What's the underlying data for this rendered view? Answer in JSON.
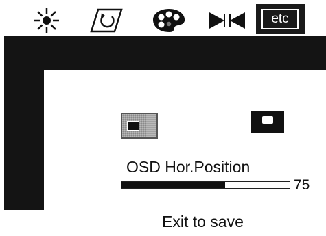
{
  "tabs": [
    {
      "icon": "brightness-sun-icon"
    },
    {
      "icon": "geometry-rotate-icon"
    },
    {
      "icon": "color-palette-icon"
    },
    {
      "icon": "size-bowtie-icon"
    },
    {
      "label": "etc",
      "icon": "etc-icon",
      "selected": true
    }
  ],
  "setting": {
    "label": "OSD Hor.Position",
    "value": 75,
    "value_text": "75",
    "min_icon": "osd-left-position-icon",
    "max_icon": "osd-right-position-icon"
  },
  "footer": {
    "exit_text": "Exit to save"
  },
  "colors": {
    "frame": "#141414",
    "background": "#ffffff",
    "selected_tab": "#1a1a1a",
    "slider_fill": "#111111"
  }
}
